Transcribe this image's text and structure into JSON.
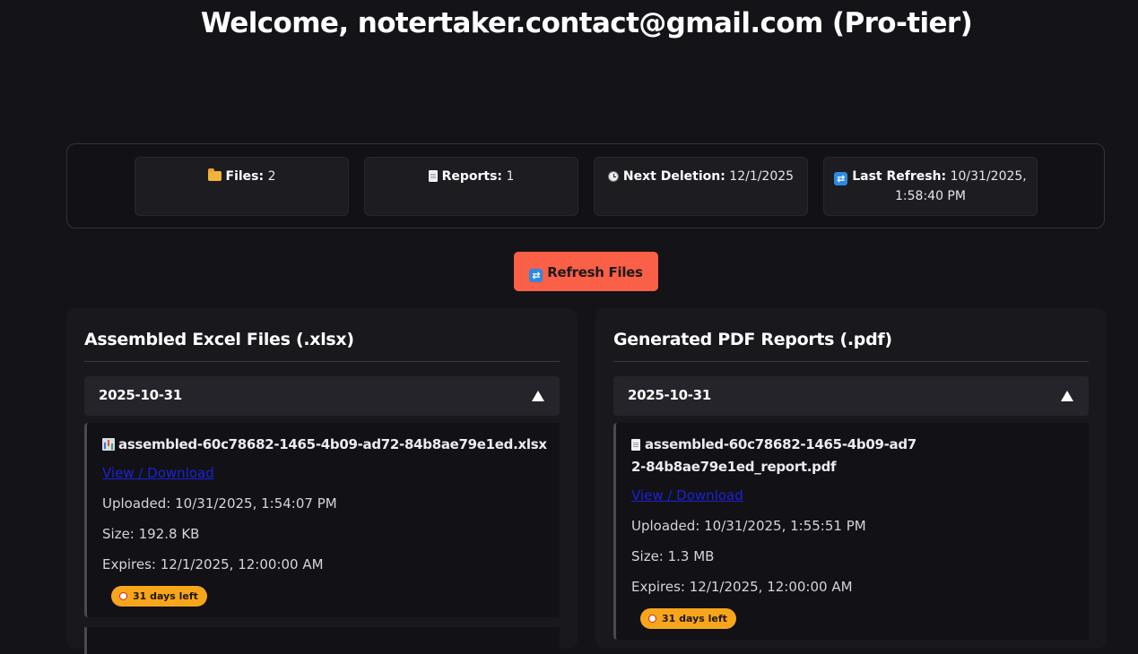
{
  "header": {
    "welcome": "Welcome, notertaker.contact@gmail.com (Pro-tier)"
  },
  "stats": {
    "files_label": "Files:",
    "files_value": "2",
    "reports_label": "Reports:",
    "reports_value": "1",
    "next_deletion_label": "Next Deletion:",
    "next_deletion_value": "12/1/2025",
    "last_refresh_label": "Last Refresh:",
    "last_refresh_value": "10/31/2025, 1:58:40 PM"
  },
  "refresh_button": {
    "label": "Refresh Files"
  },
  "excel_panel": {
    "title": "Assembled Excel Files (.xlsx)",
    "group": {
      "date": "2025-10-31",
      "expanded": true
    },
    "file": {
      "name": "assembled-60c78682-1465-4b09-ad72-84b8ae79e1ed.xlsx",
      "link": "View / Download",
      "uploaded": "Uploaded: 10/31/2025, 1:54:07 PM",
      "size": "Size: 192.8 KB",
      "expires": "Expires: 12/1/2025, 12:00:00 AM",
      "badge": "31 days left"
    }
  },
  "pdf_panel": {
    "title": "Generated PDF Reports (.pdf)",
    "group": {
      "date": "2025-10-31",
      "expanded": true
    },
    "file": {
      "name": "assembled-60c78682-1465-4b09-ad72-84b8ae79e1ed_report.pdf",
      "link": "View / Download",
      "uploaded": "Uploaded: 10/31/2025, 1:55:51 PM",
      "size": "Size: 1.3 MB",
      "expires": "Expires: 12/1/2025, 12:00:00 AM",
      "badge": "31 days left"
    }
  },
  "colors": {
    "background": "#141317",
    "accent_button": "#fa5f47",
    "badge": "#f7a61c",
    "link": "#1b22d6"
  },
  "icons": [
    "folder-icon",
    "document-icon",
    "clock-icon",
    "refresh-icon",
    "spreadsheet-icon",
    "triangle-up-icon",
    "alarm-clock-icon"
  ]
}
